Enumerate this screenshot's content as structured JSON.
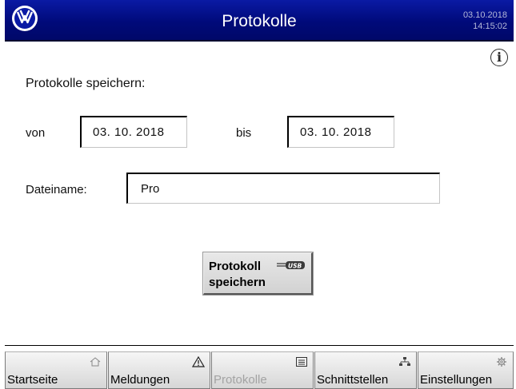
{
  "header": {
    "title": "Protokolle",
    "date": "03.10.2018",
    "time": "14:15:02",
    "logo": "vw-logo"
  },
  "main": {
    "info_icon": "info-icon",
    "section_label": "Protokolle speichern:",
    "from_label": "von",
    "from_date": "03. 10. 2018",
    "to_label": "bis",
    "to_date": "03. 10. 2018",
    "filename_label": "Dateiname:",
    "filename_value": "Pro",
    "save_button": {
      "line1": "Protokoll",
      "line2": "speichern",
      "icon": "usb-icon"
    }
  },
  "tabs": [
    {
      "label": "Startseite",
      "icon": "home-icon",
      "active": false
    },
    {
      "label": "Meldungen",
      "icon": "warning-icon",
      "active": false
    },
    {
      "label": "Protokolle",
      "icon": "list-icon",
      "active": true
    },
    {
      "label": "Schnittstellen",
      "icon": "network-icon",
      "active": false
    },
    {
      "label": "Einstellungen",
      "icon": "gear-icon",
      "active": false
    }
  ],
  "colors": {
    "titlebar": "#000a7a",
    "inactive_tab_text": "#a3a3a3"
  }
}
